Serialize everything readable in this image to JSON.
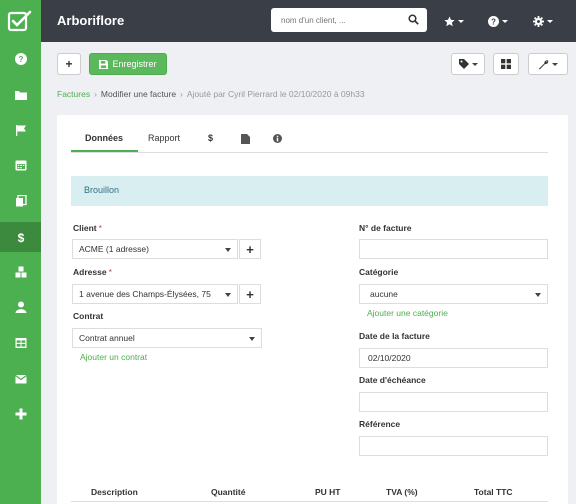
{
  "app": {
    "title": "Arboriflore"
  },
  "search": {
    "placeholder": "nom d'un client, ..."
  },
  "sidebar": {
    "items": [
      {
        "icon": "help-icon"
      },
      {
        "icon": "folder-icon"
      },
      {
        "icon": "flag-icon"
      },
      {
        "icon": "calendar-icon"
      },
      {
        "icon": "files-icon"
      },
      {
        "icon": "dollar-icon",
        "active": true
      },
      {
        "icon": "cubes-icon"
      },
      {
        "icon": "user-icon"
      },
      {
        "icon": "table-icon"
      },
      {
        "icon": "envelope-icon"
      },
      {
        "icon": "plus-icon"
      }
    ]
  },
  "toolbar": {
    "add_label": "+",
    "save_label": "Enregistrer"
  },
  "breadcrumb": {
    "root": "Factures",
    "separator": "›",
    "current": "Modifier une facture",
    "meta": "Ajouté par Cyril Pierrard le 02/10/2020 à 09h33"
  },
  "tabs": {
    "donnees": "Données",
    "rapport": "Rapport",
    "dollar": "$"
  },
  "status": {
    "text": "Brouillon"
  },
  "form": {
    "client_label": "Client",
    "client_value": "ACME (1 adresse)",
    "adresse_label": "Adresse",
    "adresse_value": "1 avenue des Champs-Élysées, 75",
    "contrat_label": "Contrat",
    "contrat_value": "Contrat annuel",
    "add_contrat": "Ajouter un contrat",
    "required_mark": "*",
    "plus": "+",
    "numero_label": "N° de facture",
    "numero_value": "",
    "categorie_label": "Catégorie",
    "categorie_value": "aucune",
    "add_categorie": "Ajouter une catégorie",
    "date_label": "Date de la facture",
    "date_value": "02/10/2020",
    "echeance_label": "Date d'échéance",
    "echeance_value": "",
    "reference_label": "Référence",
    "reference_value": ""
  },
  "table": {
    "headers": [
      "Description",
      "Quantité",
      "PU HT",
      "TVA (%)",
      "Total TTC"
    ]
  },
  "colors": {
    "sidebar": "#4caf50",
    "topbar": "#3a3f47",
    "accent": "#5cb85c",
    "alert_bg": "#d9eef1"
  }
}
